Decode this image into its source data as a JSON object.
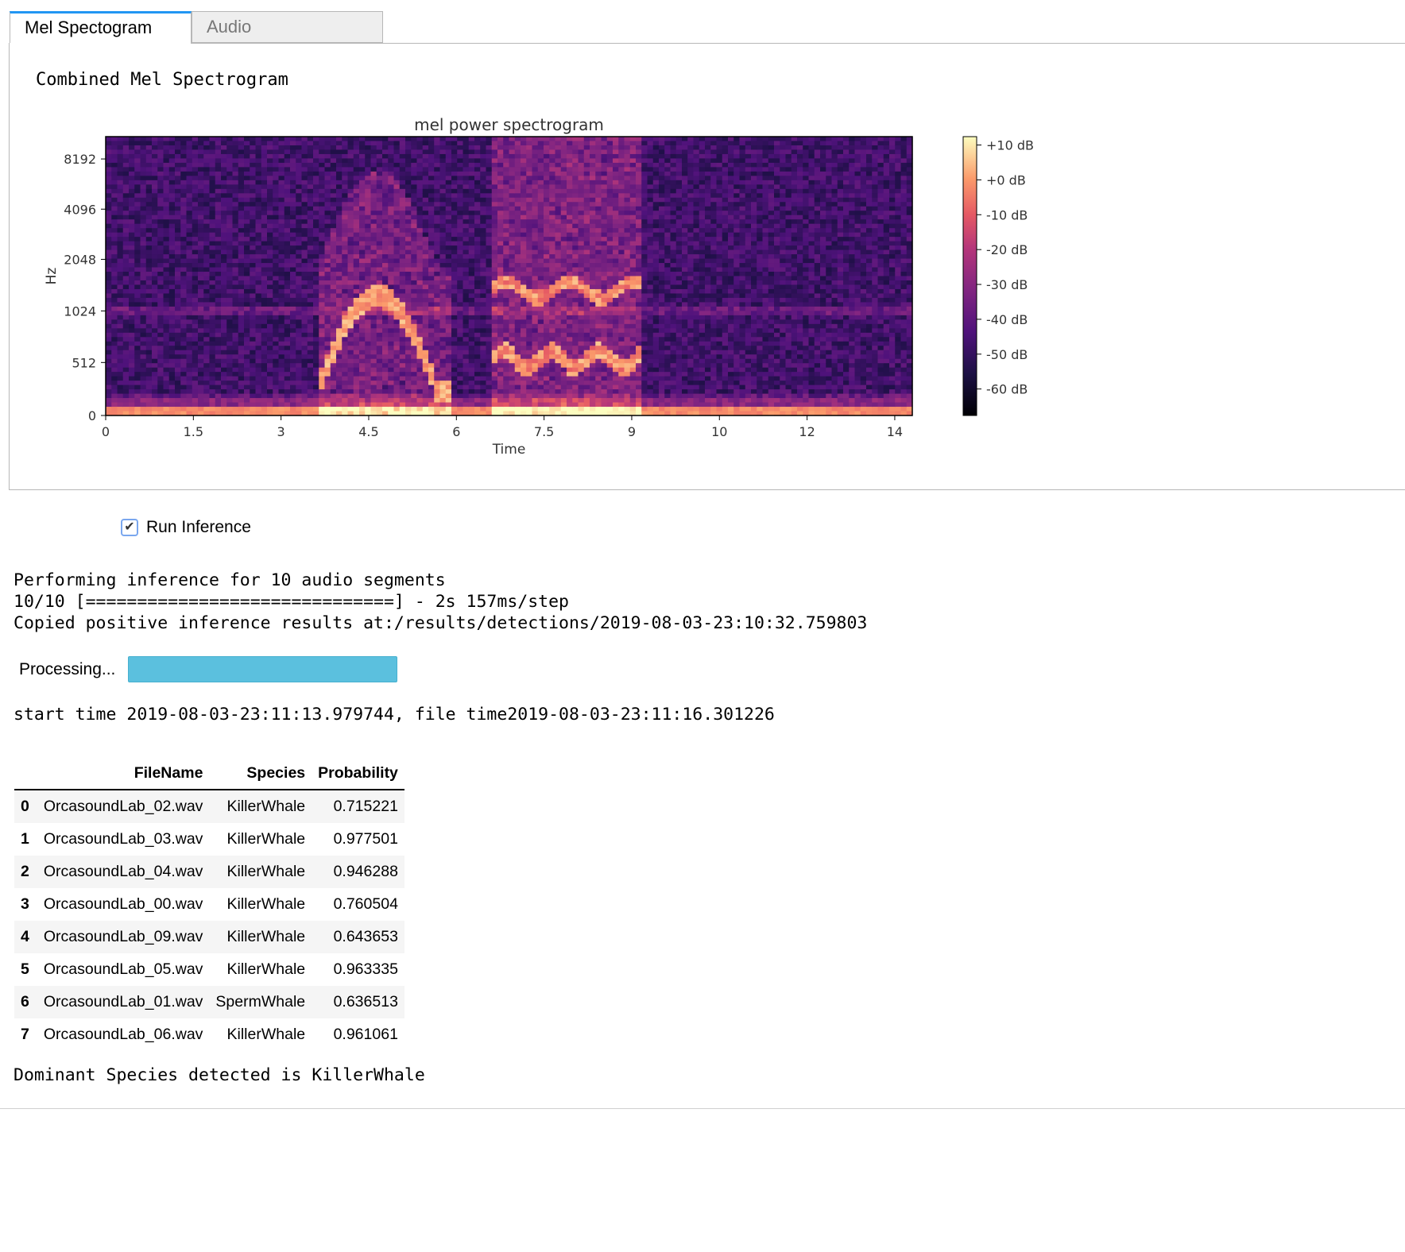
{
  "tabs": [
    {
      "label": "Mel Spectogram",
      "active": true
    },
    {
      "label": "Audio",
      "active": false
    }
  ],
  "panel": {
    "title": "Combined Mel Spectrogram"
  },
  "chart_data": {
    "type": "heatmap",
    "title": "mel power spectrogram",
    "xlabel": "Time",
    "ylabel": "Hz",
    "x_ticks": [
      "0",
      "1.5",
      "3",
      "4.5",
      "6",
      "7.5",
      "9",
      "10",
      "12",
      "14"
    ],
    "x_tick_values": [
      0,
      1.5,
      3,
      4.5,
      6,
      7.5,
      9,
      10.5,
      12,
      13.5
    ],
    "xlim": [
      0,
      13.8
    ],
    "y_ticks": [
      "0",
      "512",
      "1024",
      "2048",
      "4096",
      "8192"
    ],
    "y_scale": "mel",
    "colorbar": {
      "ticks": [
        "+10 dB",
        "+0 dB",
        "-10 dB",
        "-20 dB",
        "-30 dB",
        "-40 dB",
        "-50 dB",
        "-60 dB"
      ],
      "range_db": [
        -70,
        10
      ],
      "colormap": "magma"
    },
    "bright_regions": [
      {
        "t_start": 3.6,
        "t_end": 5.9,
        "description": "rising call"
      },
      {
        "t_start": 6.6,
        "t_end": 9.2,
        "description": "broadband call"
      }
    ]
  },
  "run_inference": {
    "label": "Run Inference",
    "checked": true
  },
  "output": {
    "line1": "Performing inference for 10 audio segments",
    "line2": "10/10 [==============================] - 2s 157ms/step",
    "line3": "Copied positive inference results at:/results/detections/2019-08-03-23:10:32.759803",
    "processing_label": "Processing...",
    "progress": 1.0,
    "time_line": "start time 2019-08-03-23:11:13.979744, file time2019-08-03-23:11:16.301226",
    "dominant": "Dominant Species detected is KillerWhale"
  },
  "table": {
    "columns": [
      "",
      "FileName",
      "Species",
      "Probability"
    ],
    "rows": [
      {
        "idx": "0",
        "file": "OrcasoundLab_02.wav",
        "species": "KillerWhale",
        "prob": "0.715221"
      },
      {
        "idx": "1",
        "file": "OrcasoundLab_03.wav",
        "species": "KillerWhale",
        "prob": "0.977501"
      },
      {
        "idx": "2",
        "file": "OrcasoundLab_04.wav",
        "species": "KillerWhale",
        "prob": "0.946288"
      },
      {
        "idx": "3",
        "file": "OrcasoundLab_00.wav",
        "species": "KillerWhale",
        "prob": "0.760504"
      },
      {
        "idx": "4",
        "file": "OrcasoundLab_09.wav",
        "species": "KillerWhale",
        "prob": "0.643653"
      },
      {
        "idx": "5",
        "file": "OrcasoundLab_05.wav",
        "species": "KillerWhale",
        "prob": "0.963335"
      },
      {
        "idx": "6",
        "file": "OrcasoundLab_01.wav",
        "species": "SpermWhale",
        "prob": "0.636513"
      },
      {
        "idx": "7",
        "file": "OrcasoundLab_06.wav",
        "species": "KillerWhale",
        "prob": "0.961061"
      }
    ]
  },
  "colors": {
    "tab_accent": "#2196f3",
    "progress": "#5bc0de"
  }
}
